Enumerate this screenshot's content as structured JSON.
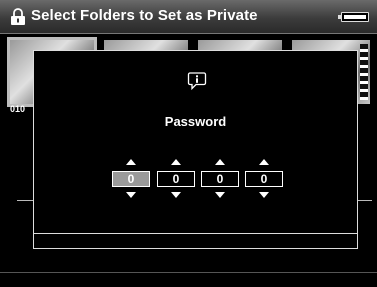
{
  "header": {
    "title": "Select Folders to Set as Private"
  },
  "icons": {
    "lock": "lock-icon",
    "battery": "battery-icon",
    "info": "info-icon"
  },
  "background": {
    "folder_label": "010"
  },
  "dialog": {
    "title": "Password",
    "digits": [
      "0",
      "0",
      "0",
      "0"
    ],
    "active_digit": 0
  },
  "colors": {
    "background": "#000000",
    "text": "#ffffff",
    "active_digit_fill": "#9a9a9a"
  }
}
